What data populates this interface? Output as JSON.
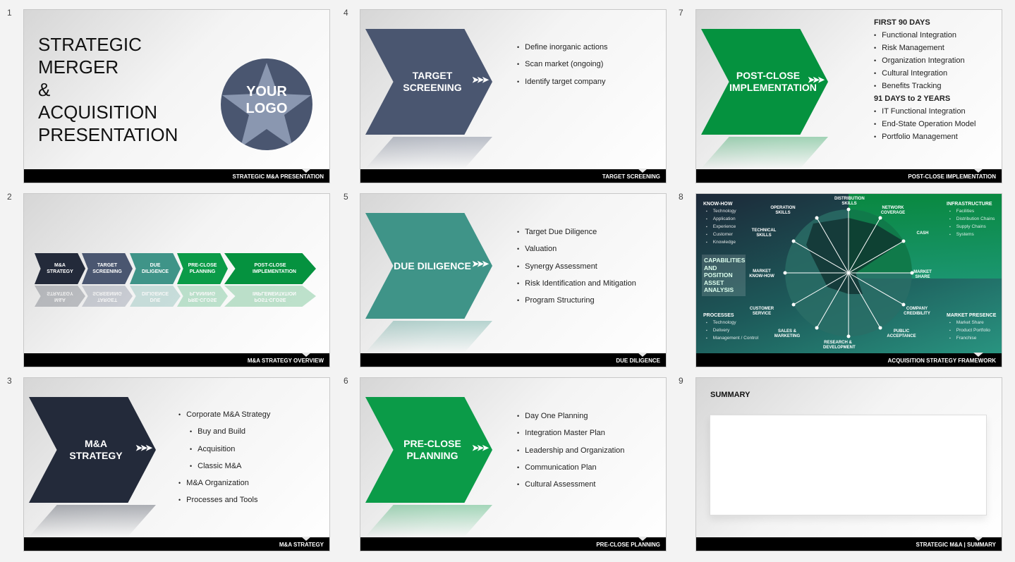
{
  "slides": [
    {
      "number": "1",
      "title_lines": [
        "STRATEGIC",
        "MERGER",
        "&",
        "ACQUISITION",
        "PRESENTATION"
      ],
      "logo": "YOUR LOGO",
      "footer": "STRATEGIC M&A PRESENTATION"
    },
    {
      "number": "2",
      "steps": [
        "M&A STRATEGY",
        "TARGET SCREENING",
        "DUE DILIGENCE",
        "PRE-CLOSE PLANNING",
        "POST-CLOSE IMPLEMENTATION"
      ],
      "footer": "M&A STRATEGY OVERVIEW"
    },
    {
      "number": "3",
      "chevron": "M&A STRATEGY",
      "bullets": [
        {
          "t": "Corporate M&A Strategy"
        },
        {
          "t": "Buy and Build",
          "sub": true
        },
        {
          "t": "Acquisition",
          "sub": true
        },
        {
          "t": "Classic M&A",
          "sub": true
        },
        {
          "t": "M&A Organization"
        },
        {
          "t": "Processes and Tools"
        }
      ],
      "footer": "M&A STRATEGY",
      "color": "#232a3a"
    },
    {
      "number": "4",
      "chevron": "TARGET SCREENING",
      "bullets": [
        "Define inorganic actions",
        "Scan market (ongoing)",
        "Identify target company"
      ],
      "footer": "TARGET SCREENING",
      "color": "#4a5670"
    },
    {
      "number": "5",
      "chevron": "DUE DILIGENCE",
      "bullets": [
        "Target Due Diligence",
        "Valuation",
        "Synergy Assessment",
        "Risk Identification and Mitigation",
        "Program Structuring"
      ],
      "footer": "DUE DILIGENCE",
      "color": "#3f9488"
    },
    {
      "number": "6",
      "chevron": "PRE-CLOSE PLANNING",
      "bullets": [
        "Day One Planning",
        "Integration Master Plan",
        "Leadership and Organization",
        "Communication Plan",
        "Cultural Assessment"
      ],
      "footer": "PRE-CLOSE PLANNING",
      "color": "#0b9b48"
    },
    {
      "number": "7",
      "chevron": "POST-CLOSE IMPLEMENTATION",
      "h1": "FIRST 90 DAYS",
      "list1": [
        "Functional Integration",
        "Risk Management",
        "Organization Integration",
        "Cultural Integration",
        "Benefits Tracking"
      ],
      "h2": "91 DAYS to 2 YEARS",
      "list2": [
        "IT Functional Integration",
        "End-State Operation Model",
        "Portfolio Management"
      ],
      "footer": "POST-CLOSE IMPLEMENTATION",
      "color": "#05923f"
    },
    {
      "number": "8",
      "center_label": "CAPABILITIES AND POSITION ASSET ANALYSIS",
      "radar_labels": [
        "DISTRIBUTION SKILLS",
        "NETWORK COVERAGE",
        "CASH",
        "MARKET SHARE",
        "COMPANY CREDIBILITY",
        "PUBLIC ACCEPTANCE",
        "RESEARCH & DEVELOPMENT",
        "SALES & MARKETING",
        "CUSTOMER SERVICE",
        "MARKET KNOW-HOW",
        "TECHNICAL SKILLS",
        "OPERATION SKILLS"
      ],
      "groups": [
        {
          "title": "KNOW-HOW",
          "items": [
            "Technology",
            "Application",
            "Experience",
            "Customer",
            "Knowledge"
          ]
        },
        {
          "title": "INFRASTRUCTURE",
          "items": [
            "Facilities",
            "Distribution Chains",
            "Supply Chains",
            "Systems"
          ]
        },
        {
          "title": "PROCESSES",
          "items": [
            "Technology",
            "Delivery",
            "Management / Control"
          ]
        },
        {
          "title": "MARKET PRESENCE",
          "items": [
            "Market Share",
            "Product Portfolio",
            "Franchise"
          ]
        }
      ],
      "footer": "ACQUISITION STRATEGY FRAMEWORK"
    },
    {
      "number": "9",
      "title": "SUMMARY",
      "footer": "STRATEGIC M&A | SUMMARY"
    }
  ],
  "colors": {
    "ma": "#232a3a",
    "target": "#4a5670",
    "due": "#3f9488",
    "pre": "#0b9b48",
    "post": "#05923f"
  }
}
